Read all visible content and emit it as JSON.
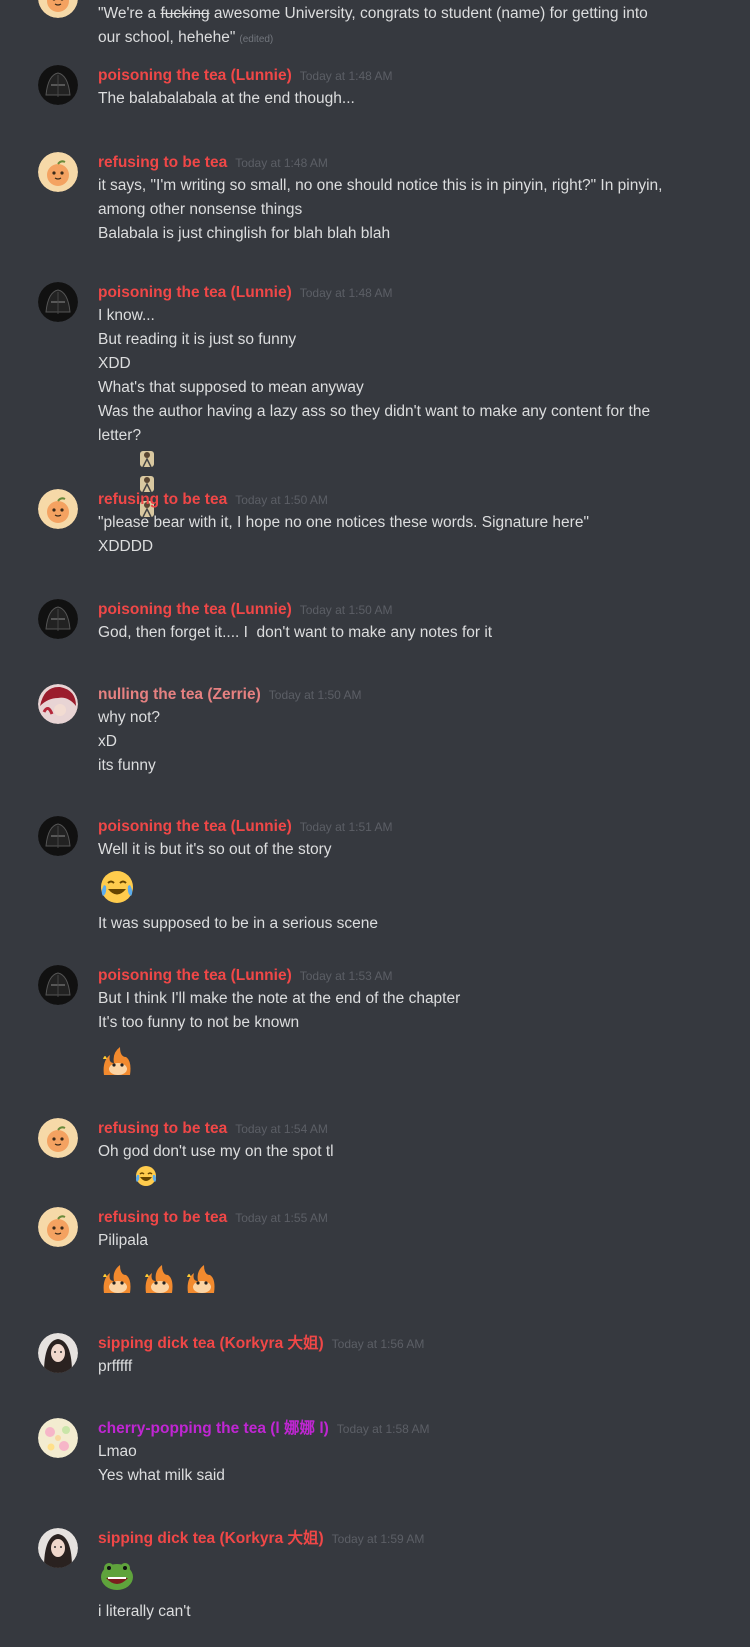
{
  "channel_messages": [
    {
      "id": "m0",
      "author": "",
      "timestamp": "",
      "lines": [],
      "partial": {
        "quote_open": "\"We're a ",
        "struck": "fucking",
        "rest1": " awesome University, congrats to student (name) for getting into",
        "rest2": "our school, hehehe\"",
        "edited": "(edited)"
      }
    },
    {
      "id": "m1",
      "author": "poisoning the tea (Lunnie)",
      "timestamp": "Today at 1:48 AM",
      "lines": [
        "The balabalabala at the end though..."
      ]
    },
    {
      "id": "m2",
      "author": "refusing to be tea",
      "timestamp": "Today at 1:48 AM",
      "lines": [
        "it says, \"I'm writing so small, no one should notice this is in pinyin, right?\" In pinyin,",
        "among other nonsense things",
        "Balabala is just chinglish for blah blah blah"
      ]
    },
    {
      "id": "m3",
      "author": "poisoning the tea (Lunnie)",
      "timestamp": "Today at 1:48 AM",
      "lines": [
        "I know...",
        "But reading it is just so funny",
        "XDD",
        "What's that supposed to mean anyway",
        "Was the author having a lazy ass so they didn't want to make any content for the",
        "letter?"
      ]
    },
    {
      "id": "m4",
      "author": "refusing to be tea",
      "timestamp": "Today at 1:50 AM",
      "lines": [
        "\"please bear with it, I hope no one notices these words. Signature here\"",
        "XDDDD"
      ]
    },
    {
      "id": "m5",
      "author": "poisoning the tea (Lunnie)",
      "timestamp": "Today at 1:50 AM",
      "lines": [
        "God, then forget it.... I  don't want to make any notes for it"
      ]
    },
    {
      "id": "m6",
      "author": "nulling the tea (Zerrie)",
      "timestamp": "Today at 1:50 AM",
      "lines": [
        "why not?",
        "xD",
        "its funny"
      ]
    },
    {
      "id": "m7",
      "author": "poisoning the tea (Lunnie)",
      "timestamp": "Today at 1:51 AM",
      "lines": [
        "Well it is but it's so out of the story",
        "It was supposed to be in a serious scene"
      ]
    },
    {
      "id": "m8",
      "author": "poisoning the tea (Lunnie)",
      "timestamp": "Today at 1:53 AM",
      "lines": [
        "But I think I'll make the note at the end of the chapter",
        "It's too funny to not be known"
      ]
    },
    {
      "id": "m9",
      "author": "refusing to be tea",
      "timestamp": "Today at 1:54 AM",
      "lines": [
        "Oh god don't use my on the spot tl"
      ]
    },
    {
      "id": "m10",
      "author": "refusing to be tea",
      "timestamp": "Today at 1:55 AM",
      "lines": [
        "Pilipala"
      ]
    },
    {
      "id": "m11",
      "author": "sipping dick tea (Korkyra 大姐)",
      "timestamp": "Today at 1:56 AM",
      "lines": [
        "prfffff"
      ]
    },
    {
      "id": "m12",
      "author": "cherry-popping the tea (l 娜娜 l)",
      "timestamp": "Today at 1:58 AM",
      "lines": [
        "Lmao",
        "Yes what milk said"
      ]
    },
    {
      "id": "m13",
      "author": "sipping dick tea (Korkyra 大姐)",
      "timestamp": "Today at 1:59 AM",
      "lines": [
        "i literally can't"
      ]
    }
  ],
  "colors": {
    "background": "#36393f",
    "lunnie": "#f04747",
    "refusing": "#f04747",
    "zerrie": "#e68181",
    "korkyra": "#f04747",
    "cherry": "#c026d3",
    "text": "#dcddde",
    "timestamp": "#5c5f66"
  },
  "icons": {
    "lunnie_avatar": "dark-helmet-avatar",
    "refusing_avatar": "peach-bun-avatar",
    "zerrie_avatar": "red-hair-avatar",
    "korkyra_avatar": "portrait-avatar",
    "cherry_avatar": "flower-avatar"
  }
}
